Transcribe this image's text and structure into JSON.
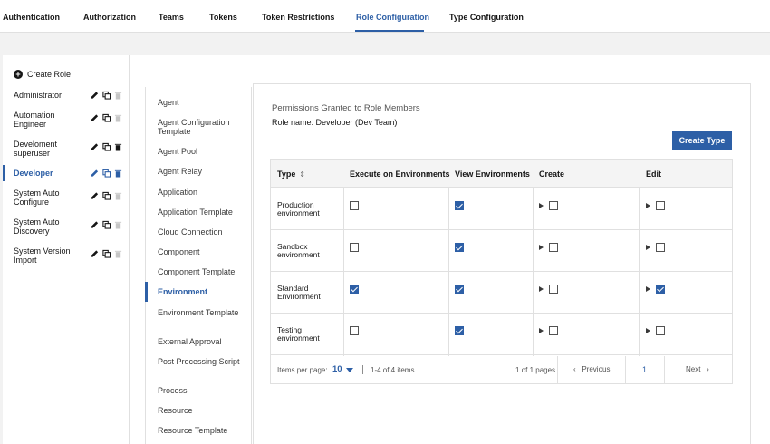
{
  "top_tabs": [
    "Authentication",
    "Authorization",
    "Teams",
    "Tokens",
    "Token Restrictions",
    "Role Configuration",
    "Type Configuration"
  ],
  "active_tab": "Role Configuration",
  "sidebar": {
    "create_label": "Create Role",
    "roles": [
      {
        "name": "Administrator"
      },
      {
        "name": "Automation Engineer"
      },
      {
        "name": "Develoment superuser"
      },
      {
        "name": "Developer",
        "active": true
      },
      {
        "name": "System Auto Configure"
      },
      {
        "name": "System Auto Discovery"
      },
      {
        "name": "System Version Import"
      }
    ]
  },
  "types": [
    "Agent",
    "Agent Configuration Template",
    "Agent Pool",
    "Agent Relay",
    "Application",
    "Application Template",
    "Cloud Connection",
    "Component",
    "Component Template",
    "Environment",
    "Environment Template",
    "External Approval",
    "Post Processing Script",
    "Process",
    "Resource",
    "Resource Template"
  ],
  "active_type": "Environment",
  "panel": {
    "title": "Permissions Granted to Role Members",
    "role_name": "Role name: Developer  (Dev Team)",
    "create_button": "Create Type"
  },
  "table": {
    "headers": [
      "Type",
      "Execute on Environments",
      "View Environments",
      "Create",
      "Edit"
    ],
    "rows": [
      {
        "type": "Production environment",
        "execute": false,
        "view": true,
        "create": false,
        "edit": false
      },
      {
        "type": "Sandbox environment",
        "execute": false,
        "view": true,
        "create": false,
        "edit": false
      },
      {
        "type": "Standard Environment",
        "execute": true,
        "view": true,
        "create": false,
        "edit": true
      },
      {
        "type": "Testing environment",
        "execute": false,
        "view": true,
        "create": false,
        "edit": false
      }
    ]
  },
  "pagination": {
    "items_per_page_label": "Items per page:",
    "items_per_page": "10",
    "range": "1-4 of 4 items",
    "pages": "1 of 1 pages",
    "previous": "Previous",
    "current_page": "1",
    "next": "Next"
  },
  "colors": {
    "accent": "#2d5fa6"
  }
}
